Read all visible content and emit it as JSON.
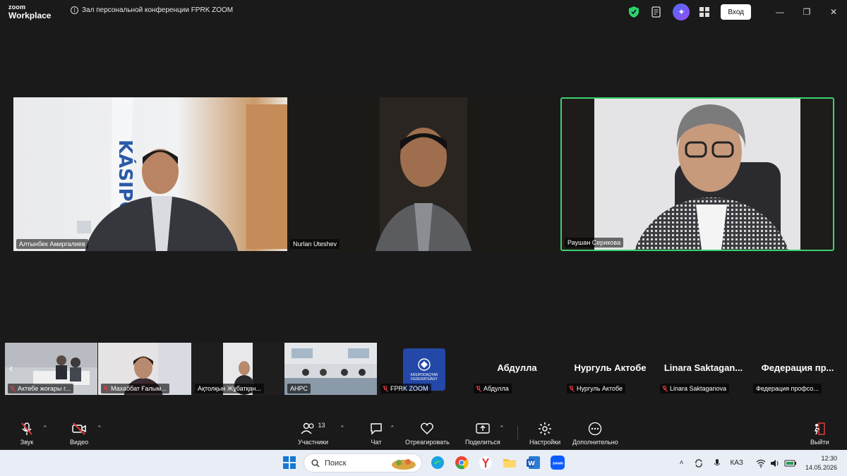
{
  "window": {
    "logo_line1": "zoom",
    "logo_line2": "Workplace",
    "meeting_title": "Зал персональной конференции FPRK ZOOM",
    "signin_label": "Вход"
  },
  "main_tiles": [
    {
      "name": "Алтынбек Амиргалиев"
    },
    {
      "name": "Nurlan Uteshev"
    },
    {
      "name": "Раушан Серикова"
    }
  ],
  "strip": [
    {
      "name": "Актөбе жоғары г...",
      "muted": true
    },
    {
      "name": "Махаббат Ғалым...",
      "muted": true
    },
    {
      "name": "Ақтолқын Жұбатқан...",
      "muted": false
    },
    {
      "name": "AHPC",
      "muted": false
    },
    {
      "name": "FPRK ZOOM",
      "muted": true,
      "logo_text": "KÁSIPODAQTAR FEDERATSIASY"
    },
    {
      "name": "Абдулла",
      "display": "Абдулла",
      "muted": true
    },
    {
      "name": "Нургуль Актобе",
      "display": "Нургуль Актобе",
      "muted": true
    },
    {
      "name": "Linara Saktaganova",
      "display": "Linara  Saktagan...",
      "muted": true
    },
    {
      "name": "Федерация профсо...",
      "display": "Федерация  пр...",
      "muted": false
    }
  ],
  "toolbar": {
    "audio": "Звук",
    "video": "Видео",
    "participants": "Участники",
    "participants_count": "13",
    "chat": "Чат",
    "react": "Отреагировать",
    "share": "Поделиться",
    "settings": "Настройки",
    "more": "Дополнительно",
    "leave": "Выйти"
  },
  "taskbar": {
    "search_placeholder": "Поиск",
    "language": "КАЗ",
    "time": "12:30",
    "date": "14.05.2026"
  },
  "colors": {
    "active_speaker_border": "#3bd16f",
    "muted_red": "#e0393e",
    "ai_gradient": "#6a5cf5"
  }
}
